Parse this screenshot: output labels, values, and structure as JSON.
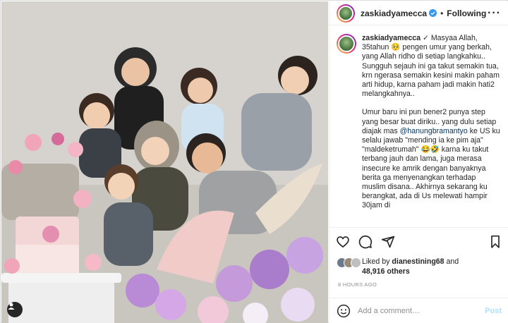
{
  "post": {
    "username": "zaskiadyamecca",
    "follow_status": "Following",
    "more_icon": "more-horizontal-icon",
    "caption_paragraphs": [
      {
        "segments": [
          {
            "type": "user",
            "text": "zaskiadyamecca"
          },
          {
            "type": "text",
            "text": " ✓ Masyaa Allah, 35tahun 🥺 pengen umur yang berkah, yang Allah ridho di setiap langkahku.. Sungguh sejauh ini ga takut semakin tua, krn ngerasa semakin kesini makin paham arti hidup, karna paham jadi makin hati2 melangkahnya.."
          }
        ]
      },
      {
        "segments": [
          {
            "type": "text",
            "text": "Umur baru ini pun bener2 punya step yang besar buat diriku.. yang dulu setiap diajak mas "
          },
          {
            "type": "mention",
            "text": "@hanungbramantyo"
          },
          {
            "type": "text",
            "text": " ke US ku selalu jawab \"mending ia ke pim aja\" \"maldeketrumah\" 😂🤣 karna ku takut terbang jauh dan lama, juga merasa insecure ke amrik dengan banyaknya berita ga menyenangkan terhadap muslim disana.. Akhirnya sekarang ku berangkat, ada di Us melewati hampir 30jam di"
          }
        ]
      }
    ],
    "liked_by_prefix": "Liked by ",
    "liked_by_user": "dianestining68",
    "liked_by_and": " and",
    "likes_count": "48,916 others",
    "time_ago": "8 HOURS AGO",
    "comment_placeholder": "Add a comment…",
    "post_label": "Post",
    "colors": {
      "link": "#00376b",
      "verified": "#3897f0",
      "post_disabled": "#b2dffc",
      "muted": "#8e8e8e"
    }
  }
}
